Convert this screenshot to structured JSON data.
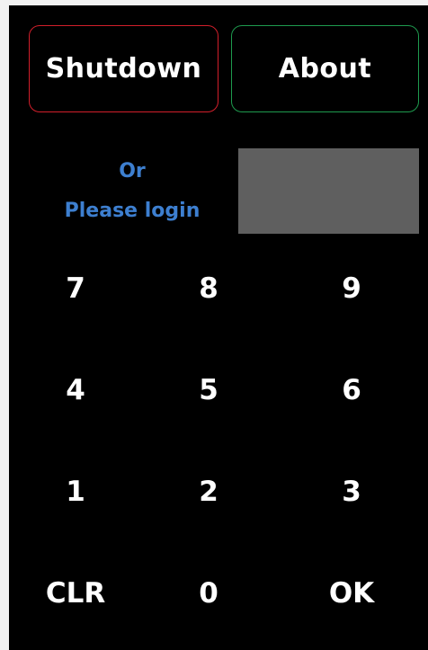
{
  "buttons": {
    "shutdown": "Shutdown",
    "about": "About"
  },
  "login": {
    "or_text": "Or",
    "please_text": "Please login",
    "pin_value": ""
  },
  "keypad": {
    "keys": [
      "7",
      "8",
      "9",
      "4",
      "5",
      "6",
      "1",
      "2",
      "3",
      "CLR",
      "0",
      "OK"
    ]
  },
  "colors": {
    "background": "#000000",
    "shutdown_border": "#d21f2b",
    "about_border": "#1e9a4e",
    "login_text": "#3d7fd0",
    "pin_box": "#5f5f5f"
  }
}
